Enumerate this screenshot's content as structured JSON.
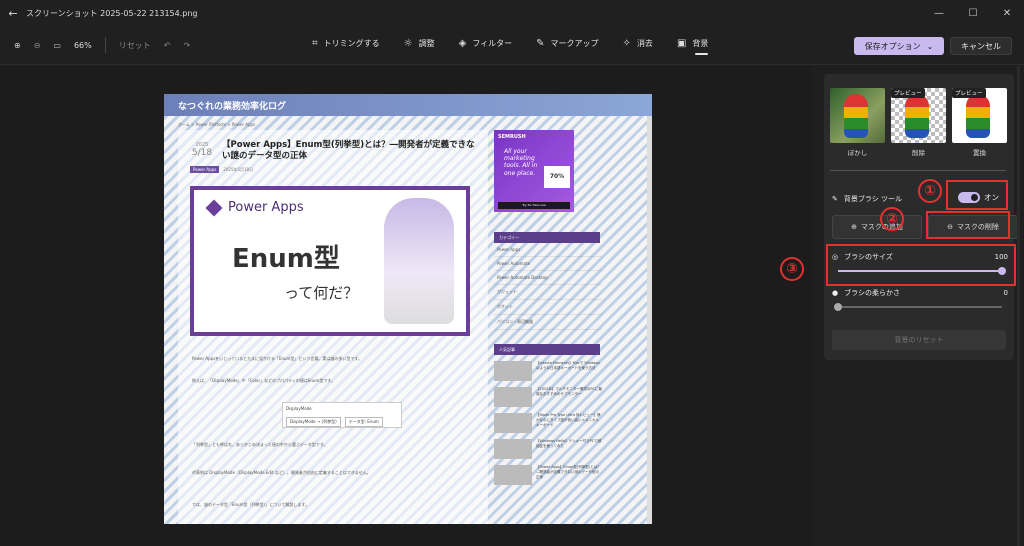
{
  "window": {
    "title": "スクリーンショット 2025-05-22 213154.png"
  },
  "toolbar": {
    "zoom": "66%",
    "reset": "リセット",
    "tools": [
      {
        "label": "トリミングする",
        "icon": "crop-icon"
      },
      {
        "label": "調整",
        "icon": "sun-icon"
      },
      {
        "label": "フィルター",
        "icon": "filter-icon"
      },
      {
        "label": "マークアップ",
        "icon": "pen-icon"
      },
      {
        "label": "消去",
        "icon": "eraser-icon"
      },
      {
        "label": "背景",
        "icon": "background-icon"
      }
    ],
    "save_label": "保存オプション",
    "cancel_label": "キャンセル"
  },
  "screenshot": {
    "site_title": "なつぐれの業務効率化ログ",
    "breadcrumb": "ホーム > Power Platform > Power Apps",
    "date_year": "2025",
    "date_md": "5/18",
    "headline": "【Power Apps】Enum型(列挙型)とは？―開発者が定義できない謎のデータ型の正体",
    "tag": "Power Apps",
    "posted": "2025年5月18日",
    "hero_brand": "Power Apps",
    "hero_main": "Enum型",
    "hero_sub": "って何だ？",
    "para1": "Power Appsをいじっているとたまに見かける「Enum型」という言葉。実は謎の多い型です。",
    "para2": "例えば、「DisplayMode」や「Color」などのプロパティの値はEnum型です。",
    "chip_top": "DisplayMode",
    "chip_left": "DisplayMode → (列挙型)",
    "chip_right": "データ型: Enum",
    "para3": "「列挙型」とも呼ばれ、あらかじめ決まった値の中から選ぶデータ型です。",
    "para4": "代表例は DisplayMode（DisplayMode.Edit など）。開発者が自由に定義することはできません。",
    "para5": "では、謎のデータ型「Enum型（列挙型）」について解説します。",
    "ad_brand": "SEMRUSH",
    "ad_text": "All your marketing tools. All in one place.",
    "ad_badge": "70%",
    "ad_cta": "Try for free now",
    "cat_header": "カテゴリー",
    "categories": [
      "Power Apps",
      "Power Automate",
      "Power Automate Desktop",
      "ガジェット",
      "ポケット",
      "パソコン・周辺機器"
    ],
    "pop_header": "人気記事",
    "popular": [
      "【Jakarta Elements】Macで Windowsのような日本語キーボードを使う方法",
      "【2025年】マルチモニター環境のPCに最適なおすすめのサブモニター",
      "【Razer Pro Type Ultra 評レビュー】静かなのにタイプ感が良い高いメカニカルキーボード",
      "【Windows Hello】テンキー付きPCで顔認証を使ってみた",
      "【Power Apps】Enum型(列挙型)とは？―開発者が定義できない謎のデータ型の正体"
    ]
  },
  "panel": {
    "thumbs": [
      {
        "label": "ぼかし",
        "preview": ""
      },
      {
        "label": "削除",
        "preview": "プレビュー"
      },
      {
        "label": "置換",
        "preview": "プレビュー"
      }
    ],
    "brush_tool_label": "背景ブラシ ツール",
    "toggle_label": "オン",
    "add_mask": "マスクの追加",
    "remove_mask": "マスクの削除",
    "brush_size_label": "ブラシのサイズ",
    "brush_size_value": "100",
    "brush_softness_label": "ブラシの柔らかさ",
    "brush_softness_value": "0",
    "reset_bg": "背景のリセット"
  },
  "annotations": {
    "n1": "①",
    "n2": "②",
    "n3": "③"
  },
  "colors": {
    "accent": "#c9b9ee",
    "annotation": "#e53030",
    "site_purple": "#6b3f98"
  }
}
